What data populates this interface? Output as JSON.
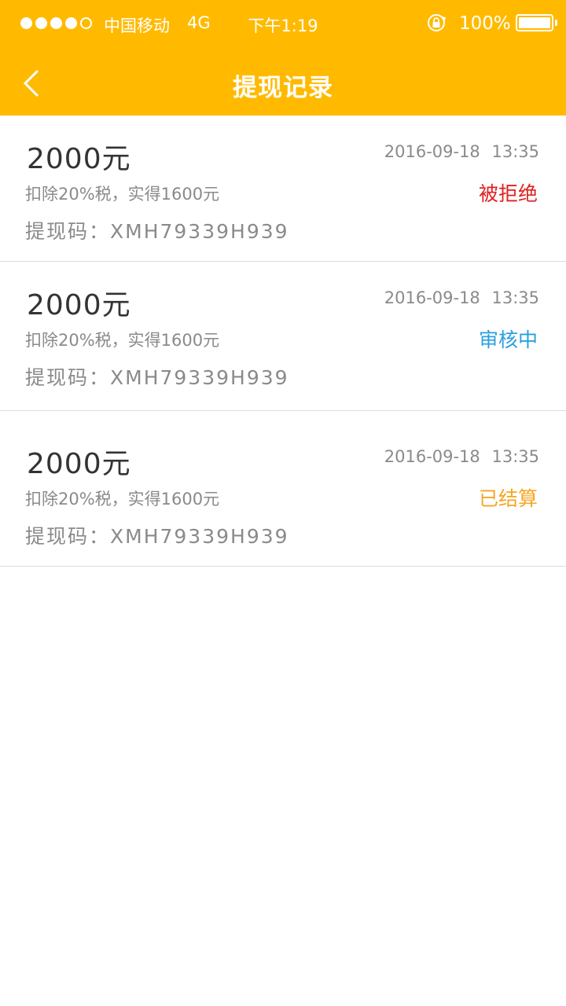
{
  "status_bar": {
    "carrier": "中国移动",
    "network": "4G",
    "time": "下午1:19",
    "battery_percent": "100%",
    "signal_bars": 4,
    "signal_total": 5
  },
  "nav": {
    "title": "提现记录",
    "back_icon": "chevron-left-icon"
  },
  "colors": {
    "brand": "#FFBA00",
    "rejected": "#E02020",
    "reviewing": "#2B9FE0",
    "settled": "#F5A623"
  },
  "records": [
    {
      "amount": "2000元",
      "datetime": "2016-09-18  13:35",
      "tax_note": "扣除20%税，实得1600元",
      "status": "被拒绝",
      "status_color": "#E02020",
      "code": "提现码：XMH79339H939"
    },
    {
      "amount": "2000元",
      "datetime": "2016-09-18  13:35",
      "tax_note": "扣除20%税，实得1600元",
      "status": "审核中",
      "status_color": "#2B9FE0",
      "code": "提现码：XMH79339H939"
    },
    {
      "amount": "2000元",
      "datetime": "2016-09-18  13:35",
      "tax_note": "扣除20%税，实得1600元",
      "status": "已结算",
      "status_color": "#F5A623",
      "code": "提现码：XMH79339H939"
    }
  ]
}
